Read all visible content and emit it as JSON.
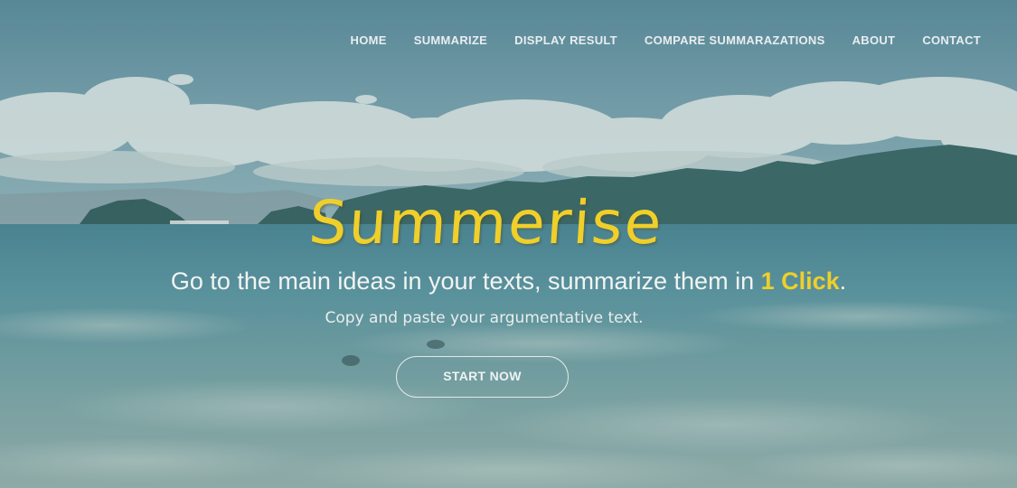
{
  "nav": {
    "items": [
      {
        "label": "HOME"
      },
      {
        "label": "SUMMARIZE"
      },
      {
        "label": "DISPLAY RESULT"
      },
      {
        "label": "COMPARE SUMMARAZATIONS"
      },
      {
        "label": "ABOUT"
      },
      {
        "label": "CONTACT"
      }
    ]
  },
  "hero": {
    "title": "Summerise",
    "tagline_pre": "Go to the main ideas in your texts, summarize them in ",
    "tagline_highlight": "1 Click",
    "tagline_post": ".",
    "subtitle": "Copy and paste your argumentative text.",
    "cta_label": "START NOW"
  },
  "colors": {
    "accent": "#f0cf2a",
    "text": "#f2f4f2",
    "sky": "#7fa9b8",
    "sea": "#6fa3ad"
  }
}
